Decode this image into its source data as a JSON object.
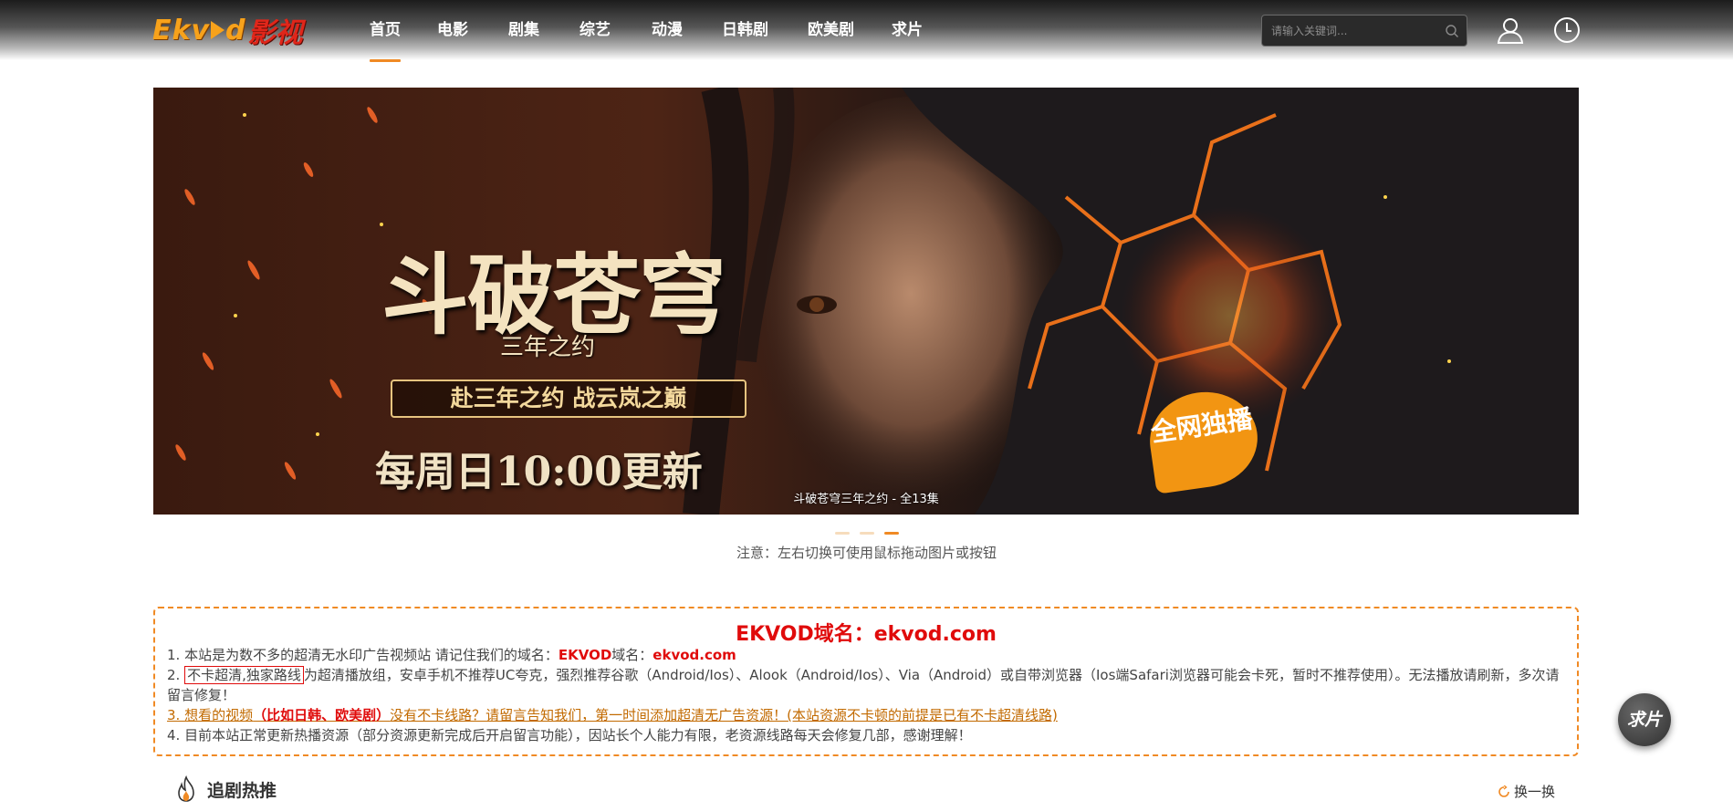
{
  "header": {
    "logo_part1": "Ekv",
    "logo_part2": "d",
    "logo_part3": "影视",
    "nav": [
      {
        "label": "首页",
        "active": true
      },
      {
        "label": "电影"
      },
      {
        "label": "剧集"
      },
      {
        "label": "综艺"
      },
      {
        "label": "动漫"
      },
      {
        "label": "日韩剧"
      },
      {
        "label": "欧美剧"
      },
      {
        "label": "求片"
      }
    ],
    "search_placeholder": "请输入关键词...",
    "search_icon": "search-icon",
    "user_icon": "user-icon",
    "history_icon": "clock-icon"
  },
  "banner": {
    "title_main": "斗破苍穹",
    "title_sub": "三年之约",
    "slogan": "赴三年之约  战云岚之巅",
    "update": "每周日10:00更新",
    "badge": "全网独播",
    "caption": "斗破苍穹三年之约 - 全13集",
    "slide_count": 3,
    "active_slide": 3
  },
  "tip": "注意：左右切换可使用鼠标拖动图片或按钮",
  "notice": {
    "title": "EKVOD域名：ekvod.com",
    "line1_prefix": "1. 本站是为数不多的超清无水印广告视频站 请记住我们的域名：",
    "line1_brand": "EKVOD",
    "line1_mid": "域名：",
    "line1_domain": "ekvod.com",
    "line2_prefix": "2. ",
    "line2_boxed": "不卡超清,独家路线",
    "line2_rest": "为超清播放组，安卓手机不推荐UC夸克，强烈推荐谷歌（Android/Ios）、Alook（Android/Ios）、Via（Android）或自带浏览器（Ios端Safari浏览器可能会卡死，暂时不推荐使用）。无法播放请刷新，多次请留言修复！",
    "line3_prefix": "3. 想看的视频",
    "line3_red": "（比如日韩、欧美剧）",
    "line3_rest": "没有不卡线路？请留言告知我们，第一时间添加超清无广告资源！(本站资源不卡顿的前提是已有不卡超清线路)",
    "line4": "4. 目前本站正常更新热播资源（部分资源更新完成后开启留言功能），因站长个人能力有限，老资源线路每天会修复几部，感谢理解！"
  },
  "section": {
    "title": "追剧热推",
    "refresh_label": "换一换",
    "icon": "fire-icon",
    "refresh_icon": "refresh-icon"
  },
  "float_button": "求片",
  "colors": {
    "accent": "#f08a24",
    "red": "#e00b0b"
  }
}
